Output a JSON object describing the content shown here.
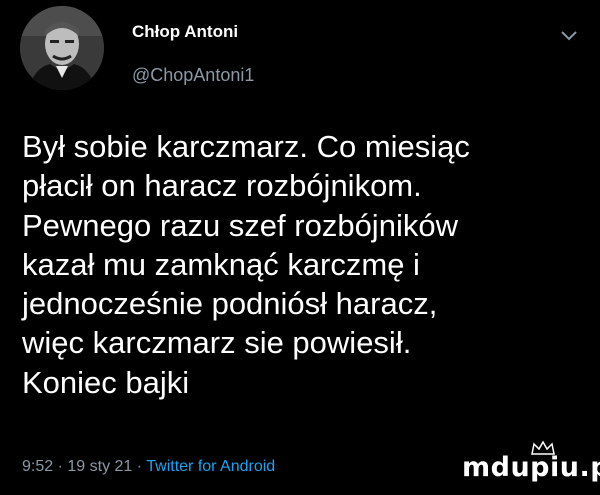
{
  "tweet": {
    "author_name": "Chłop Antoni",
    "author_handle": "@ChopAntoni1",
    "text": "Był sobie karczmarz. Co miesiąc\npłacił on haracz rozbójnikom.\nPewnego razu szef rozbójników\nkazał mu zamknąć karczmę i\njednocześnie podniósł haracz,\nwięc karczmarz sie powiesił.\nKoniec bajki",
    "time": "9:52",
    "separator": "·",
    "date": "19 sty 21",
    "source": "Twitter for Android"
  },
  "watermark": {
    "text": "mdupiu.pl"
  },
  "icons": {
    "menu": "chevron-down-icon",
    "avatar": "avatar-image"
  },
  "colors": {
    "background": "#000000",
    "text": "#ffffff",
    "secondary": "#8b98a5",
    "link": "#1da1f2"
  }
}
